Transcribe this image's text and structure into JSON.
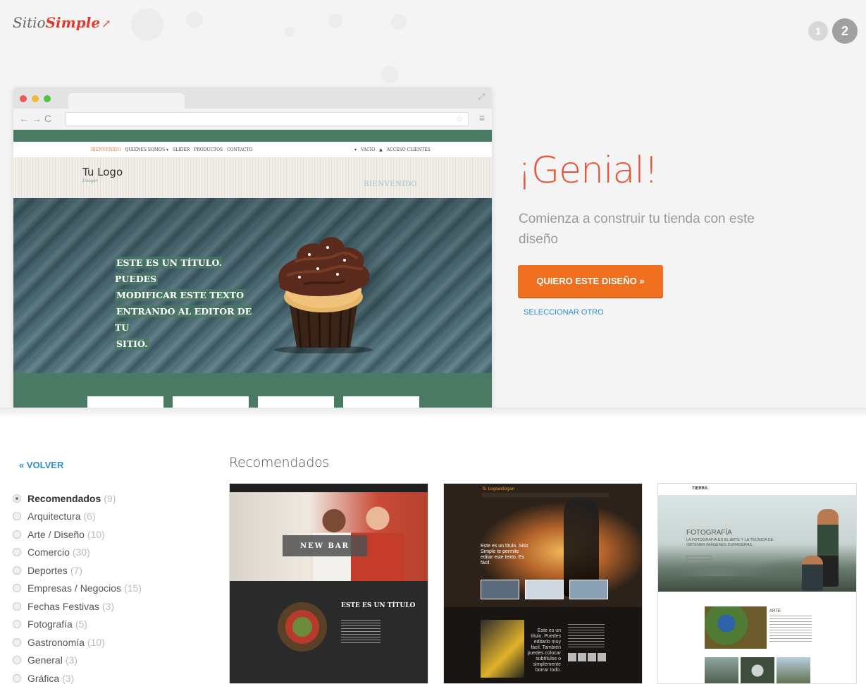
{
  "brand": {
    "name_part1": "Sitio",
    "name_part2": "Simple"
  },
  "steps": [
    "1",
    "2"
  ],
  "preview": {
    "nav_left": [
      "BIENVENIDO",
      "QUIENES SOMOS ▾",
      "SLIDER",
      "PRODUCTOS",
      "CONTACTO"
    ],
    "nav_right": [
      "VACÍO",
      "ACCESO CLIENTES"
    ],
    "logo": "Tu Logo",
    "slogan": "Eslogan",
    "welcome": "BIENVENIDO",
    "banner_lines": [
      "ESTE ES UN TÍTULO. PUEDES",
      "MODIFICAR ESTE TEXTO",
      "ENTRANDO AL EDITOR DE TU",
      "SITIO."
    ]
  },
  "hero": {
    "title": "¡Genial!",
    "subtitle": "Comienza a construir tu tienda con este diseño",
    "cta": "QUIERO ESTE DISEÑO »",
    "other": "SELECCIONAR OTRO"
  },
  "sidebar": {
    "back": "« VOLVER",
    "categories": [
      {
        "label": "Recomendados",
        "count": "(9)",
        "selected": true
      },
      {
        "label": "Arquitectura",
        "count": "(6)"
      },
      {
        "label": "Arte / Diseño",
        "count": "(10)"
      },
      {
        "label": "Comercio",
        "count": "(30)"
      },
      {
        "label": "Deportes",
        "count": "(7)"
      },
      {
        "label": "Empresas / Negocios",
        "count": "(15)"
      },
      {
        "label": "Fechas Festivas",
        "count": "(3)"
      },
      {
        "label": "Fotografía",
        "count": "(5)"
      },
      {
        "label": "Gastronomía",
        "count": "(10)"
      },
      {
        "label": "General",
        "count": "(3)"
      },
      {
        "label": "Gráfica",
        "count": "(3)"
      }
    ]
  },
  "main": {
    "section_title": "Recomendados",
    "templates": [
      {
        "bar_text": "NEW BAR",
        "heading": "ESTE ES UN TÍTULO"
      },
      {
        "logo": "Tu Logo",
        "logo_suffix": "eslogan",
        "text": "Este es un título. Sitio Simple te permite editar este texto. Es fácil.",
        "lower_text": "Este es un título. Puedes editarlo muy fácil. También puedes colocar subtítulos o simplemente borrar todo."
      },
      {
        "nav_logo": "TIERRA",
        "heading": "FOTOGRAFÍA",
        "sub": "LA FOTOGRAFÍA ES EL ARTE Y LA TÉCNICA DE OBTENER IMÁGENES DURADERAS.",
        "text_title": "ARTE"
      }
    ]
  },
  "colors": {
    "accent": "#f07020",
    "title": "#e8563a",
    "link": "#2d8fd6",
    "site_green": "#4a7a63"
  }
}
